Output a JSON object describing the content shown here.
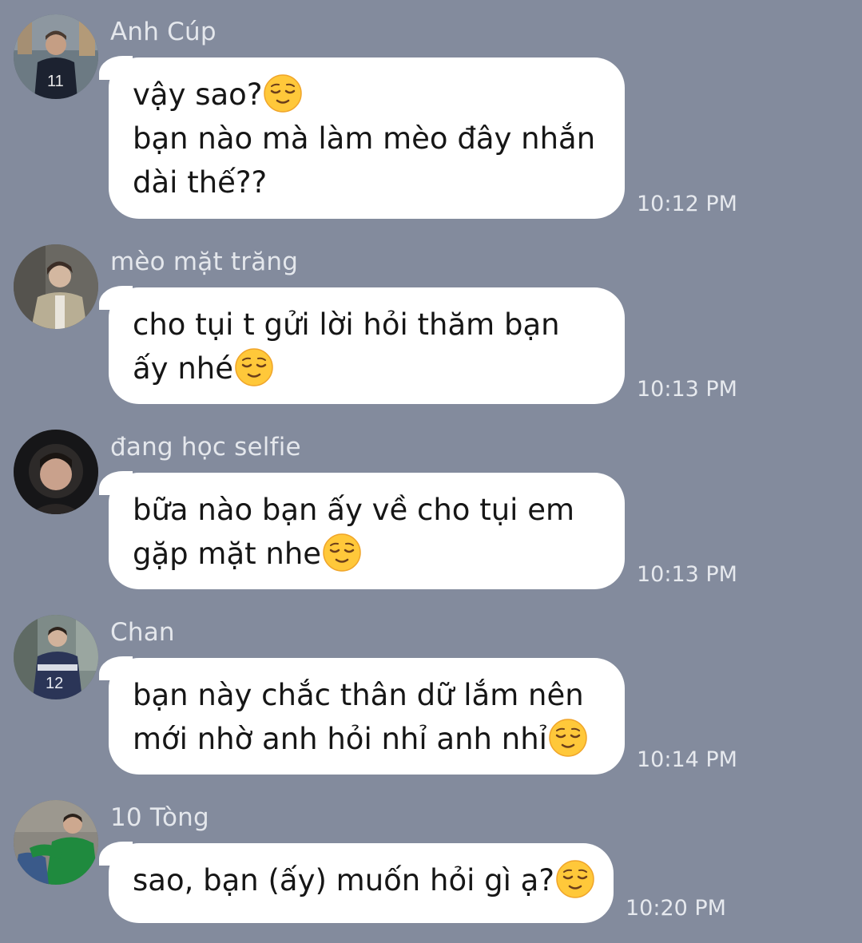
{
  "chat": {
    "messages": [
      {
        "sender": "Anh Cúp",
        "lines": [
          "vậy sao?",
          "bạn nào mà làm mèo đây nhắn",
          "dài thế??"
        ],
        "emoji_after_line": 0,
        "time": "10:12 PM",
        "avatar_icon": "avatar-photo-icon",
        "avatar_colors": [
          "#5d6b74",
          "#1d2230"
        ]
      },
      {
        "sender": "mèo mặt trăng",
        "lines": [
          "cho tụi t gửi lời hỏi thăm bạn",
          "ấy nhé"
        ],
        "emoji_after_line": 1,
        "time": "10:13 PM",
        "avatar_icon": "avatar-photo-icon",
        "avatar_colors": [
          "#6d6a63",
          "#b4ab92"
        ]
      },
      {
        "sender": "đang học selfie",
        "lines": [
          "bữa nào bạn ấy về cho tụi em",
          "gặp mặt nhe"
        ],
        "emoji_after_line": 1,
        "time": "10:13 PM",
        "avatar_icon": "avatar-photo-icon",
        "avatar_colors": [
          "#1b1b1d",
          "#8a6a58"
        ]
      },
      {
        "sender": "Chan",
        "lines": [
          "bạn này chắc thân dữ lắm nên",
          "mới nhờ anh hỏi nhỉ anh nhỉ"
        ],
        "emoji_after_line": 1,
        "time": "10:14 PM",
        "avatar_icon": "avatar-photo-icon",
        "avatar_colors": [
          "#7d8a88",
          "#2c3557"
        ]
      },
      {
        "sender": "10 Tòng",
        "lines": [
          "sao, bạn (ấy) muốn hỏi gì ạ?"
        ],
        "emoji_after_line": 0,
        "time": "10:20 PM",
        "avatar_icon": "avatar-photo-icon",
        "avatar_colors": [
          "#8a8780",
          "#1d8a3c"
        ]
      }
    ],
    "emoji_icon": "relieved-face-emoji-icon",
    "colors": {
      "background": "#838b9d",
      "bubble": "#ffffff",
      "emoji_face": "#ffc83a"
    }
  }
}
